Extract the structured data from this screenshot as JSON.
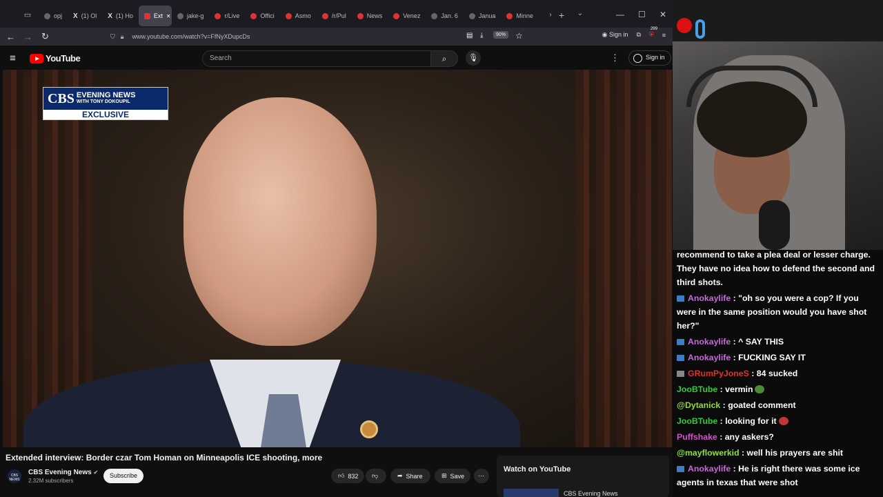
{
  "browser": {
    "tabs": [
      {
        "label": "opj",
        "icon": "chevron-left-icon"
      },
      {
        "label": "(1) Ol",
        "icon": "x-logo-icon"
      },
      {
        "label": "(1) Ho",
        "icon": "x-logo-icon"
      },
      {
        "label": "Ext",
        "icon": "youtube-icon",
        "active": true
      },
      {
        "label": "jake-g",
        "icon": "blank-icon"
      },
      {
        "label": "r/Live",
        "icon": "reddit-icon"
      },
      {
        "label": "Offici",
        "icon": "reddit-icon"
      },
      {
        "label": "Asmo",
        "icon": "reddit-icon"
      },
      {
        "label": "/r/Pul",
        "icon": "reddit-icon"
      },
      {
        "label": "News",
        "icon": "reddit-icon"
      },
      {
        "label": "Venez",
        "icon": "reddit-icon"
      },
      {
        "label": "Jan. 6",
        "icon": "abc-icon"
      },
      {
        "label": "Janua",
        "icon": "blank-icon"
      },
      {
        "label": "Minne",
        "icon": "cnn-icon"
      }
    ],
    "url": "www.youtube.com/watch?v=FfNyXDupcDs",
    "zoom": "90%",
    "sign_in": "Sign in",
    "badge_count": "299"
  },
  "youtube": {
    "logo_text": "YouTube",
    "search_placeholder": "Search",
    "sign_in": "Sign in",
    "overlay": {
      "brand": "CBS",
      "line1": "EVENING NEWS",
      "line2": "WITH TONY DOKOUPIL",
      "exclusive": "EXCLUSIVE"
    },
    "title": "Extended interview: Border czar Tom Homan on Minneapolis ICE shooting, more",
    "channel": "CBS Evening News",
    "subscribers": "2.32M subscribers",
    "avatar_text": "CBS NEWS",
    "subscribe": "Subscribe",
    "likes": "832",
    "share": "Share",
    "save": "Save",
    "watch_on_youtube": "Watch on YouTube",
    "related_channel": "CBS Evening News"
  },
  "chat": {
    "intro": "recommend to take a plea deal or lesser charge. They have no idea how to defend the second and third shots.",
    "messages": [
      {
        "user": "Anokaylife",
        "color": "#c56ad8",
        "text": "\"oh so you were a cop? If you were in the same position would you have shot her?\"",
        "badge": "blue"
      },
      {
        "user": "Anokaylife",
        "color": "#c56ad8",
        "text": "^ SAY THIS",
        "badge": "blue"
      },
      {
        "user": "Anokaylife",
        "color": "#c56ad8",
        "text": "FUCKING SAY IT",
        "badge": "blue"
      },
      {
        "user": "GRumPyJoneS",
        "color": "#e3322d",
        "text": "84 sucked",
        "badge": "mute"
      },
      {
        "user": "JooBTube",
        "color": "#33c93a",
        "text": "vermin",
        "badge": "none",
        "emote": "#4f8a3a"
      },
      {
        "user": "@Dytanick",
        "color": "#9ad93c",
        "text": "goated comment",
        "badge": "none"
      },
      {
        "user": "JooBTube",
        "color": "#33c93a",
        "text": "looking for it",
        "badge": "none",
        "emote": "#c0353a"
      },
      {
        "user": "Puffshake",
        "color": "#d84fd0",
        "text": "any askers?",
        "badge": "none"
      },
      {
        "user": "@mayflowerkid",
        "color": "#8ee04a",
        "text": "well his prayers are shit",
        "badge": "none"
      },
      {
        "user": "Anokaylife",
        "color": "#c56ad8",
        "text": "He is right there was some ice agents in texas that were shot",
        "badge": "blue"
      }
    ]
  }
}
